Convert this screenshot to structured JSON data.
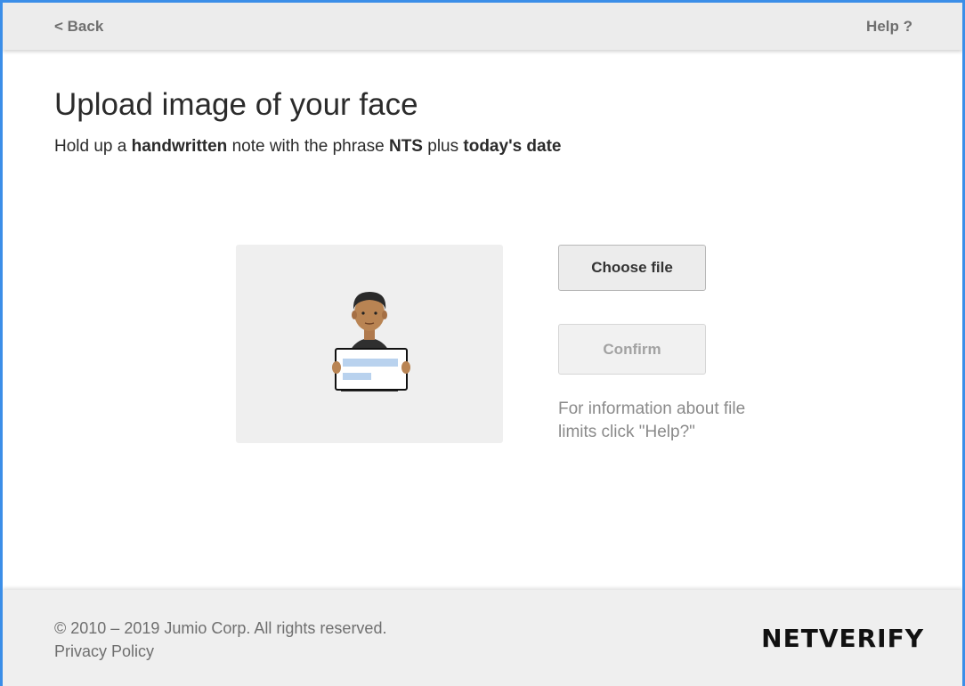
{
  "header": {
    "back_label": "< Back",
    "help_label": "Help ?"
  },
  "main": {
    "title": "Upload image of your face",
    "instruction": {
      "part1": "Hold up a ",
      "bold1": "handwritten",
      "part2": " note with the phrase ",
      "bold2": "NTS",
      "part3": " plus ",
      "bold3": "today's date"
    },
    "illustration": "person-holding-note-illustration",
    "choose_file_label": "Choose file",
    "confirm_label": "Confirm",
    "confirm_disabled": true,
    "file_info": "For information about file limits click \"Help?\""
  },
  "footer": {
    "copyright": "© 2010 – 2019 Jumio Corp. All rights reserved.",
    "privacy_label": "Privacy Policy",
    "brand": "NETVERIFY"
  },
  "colors": {
    "frame_border": "#3b8ee8",
    "bar_background": "#ececec",
    "text_dark": "#2b2b2b",
    "text_muted": "#8a8a8a"
  }
}
